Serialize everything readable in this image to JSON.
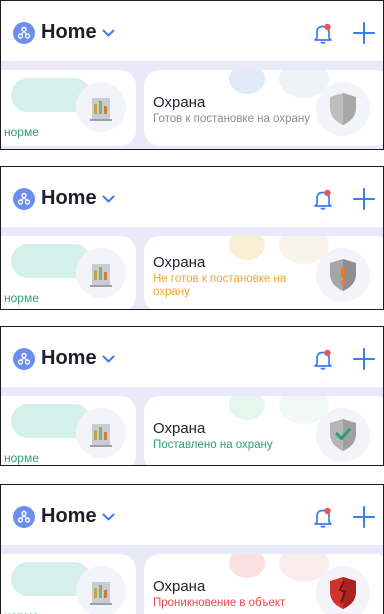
{
  "app": {
    "home_label": "Home",
    "normal_text": "норме",
    "card_title": "Охрана"
  },
  "icons": {
    "home": "hub-icon",
    "dropdown": "chevron-down-icon",
    "notifications": "bell-icon",
    "add": "plus-icon",
    "stats": "chart-tower-icon",
    "security": "shield-icon"
  },
  "colors": {
    "accent": "#3a7ef0",
    "bell_dot": "#e35a4f",
    "ok_green": "#2f9d7b",
    "band": "#e9e9f9"
  },
  "states": [
    {
      "status": "Готов к постановке на охрану",
      "status_color": "#8b8b95",
      "shield_color": "#bdbdbd",
      "shield_mark": "none"
    },
    {
      "status": "Не готов к постановке на охрану",
      "status_color": "#eba531",
      "shield_color": "#9c9c9c",
      "shield_mark": "exclamation"
    },
    {
      "status": "Поставлено на охрану",
      "status_color": "#2f9d7b",
      "shield_color": "#b5b5b5",
      "shield_mark": "check"
    },
    {
      "status": "Проникновение в объект",
      "status_color": "#e04a4a",
      "shield_color": "#c8302b",
      "shield_mark": "break"
    }
  ]
}
